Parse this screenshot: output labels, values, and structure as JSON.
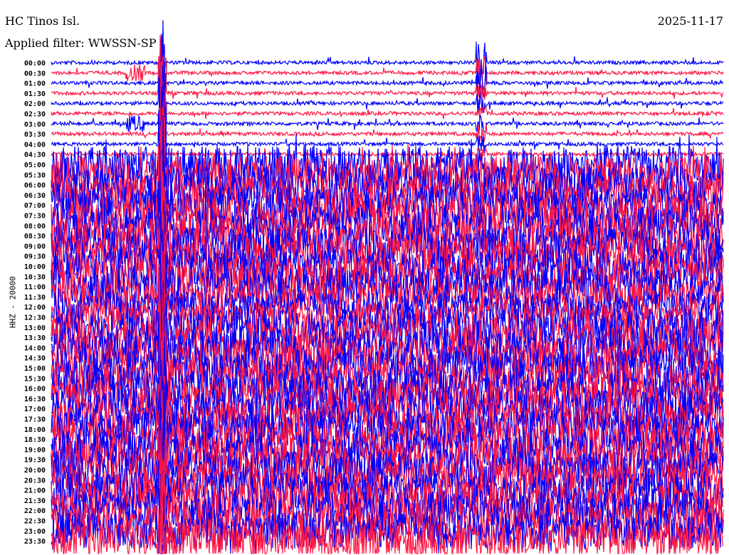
{
  "header": {
    "station": "HC Tinos Isl.",
    "filter": "Applied filter: WWSSN-SP",
    "date": "2025-11-17"
  },
  "chart_data": {
    "type": "line",
    "title": "HC Tinos Isl.",
    "subtitle": "Applied filter: WWSSN-SP",
    "ylabel": "HHZ - 20000",
    "row_labels": [
      "00:00",
      "00:30",
      "01:00",
      "01:30",
      "02:00",
      "02:30",
      "03:00",
      "03:30",
      "04:00",
      "04:30",
      "05:00",
      "05:30",
      "06:00",
      "06:30",
      "07:00",
      "07:30",
      "08:00",
      "08:30",
      "09:00",
      "09:30",
      "10:00",
      "10:30",
      "11:00",
      "11:30",
      "12:00",
      "12:30",
      "13:00",
      "13:30",
      "14:00",
      "14:30",
      "15:00",
      "15:30",
      "16:00",
      "16:30",
      "17:00",
      "17:30",
      "18:00",
      "18:30",
      "19:00",
      "19:30",
      "20:00",
      "20:30",
      "21:00",
      "21:30",
      "22:00",
      "22:30",
      "23:00",
      "23:30"
    ],
    "trace_colors": [
      "#0000ff",
      "#ff1744"
    ],
    "grid": false
  }
}
